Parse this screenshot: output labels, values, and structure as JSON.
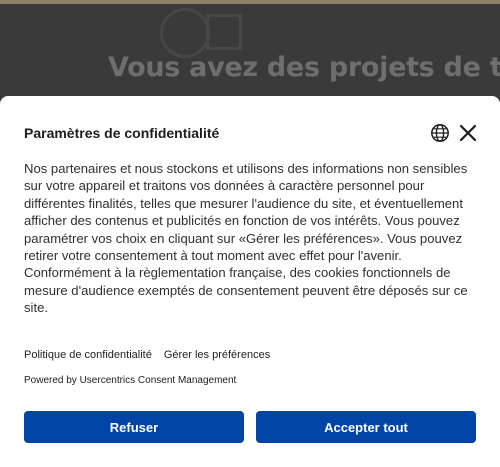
{
  "background": {
    "heading": "Vous avez des projets de t"
  },
  "dialog": {
    "title": "Paramètres de confidentialité",
    "language_icon": "globe-icon",
    "close_icon": "close-icon",
    "body": "Nos partenaires et nous stockons et utilisons des informations non sensibles sur votre appareil et traitons vos données à caractère personnel pour différentes finalités, telles que mesurer l'audience du site, et éventuellement afficher des contenus et publicités en fonction de vos intérêts. Vous pouvez paramétrer vos choix en cliquant sur «Gérer les préférences». Vous pouvez retirer votre consentement à tout moment avec effet pour l'avenir. Conformément à la règlementation française, des cookies fonctionnels de mesure d'audience exemptés de consentement peuvent être déposés sur ce site.",
    "links": {
      "privacy_policy": "Politique de confidentialité",
      "manage_preferences": "Gérer les préférences"
    },
    "powered_by": "Powered by Usercentrics Consent Management",
    "buttons": {
      "refuse": "Refuser",
      "accept_all": "Accepter tout"
    }
  },
  "colors": {
    "button_bg": "#0045a5",
    "button_text": "#ffffff",
    "overlay": "#3a3a3a"
  }
}
